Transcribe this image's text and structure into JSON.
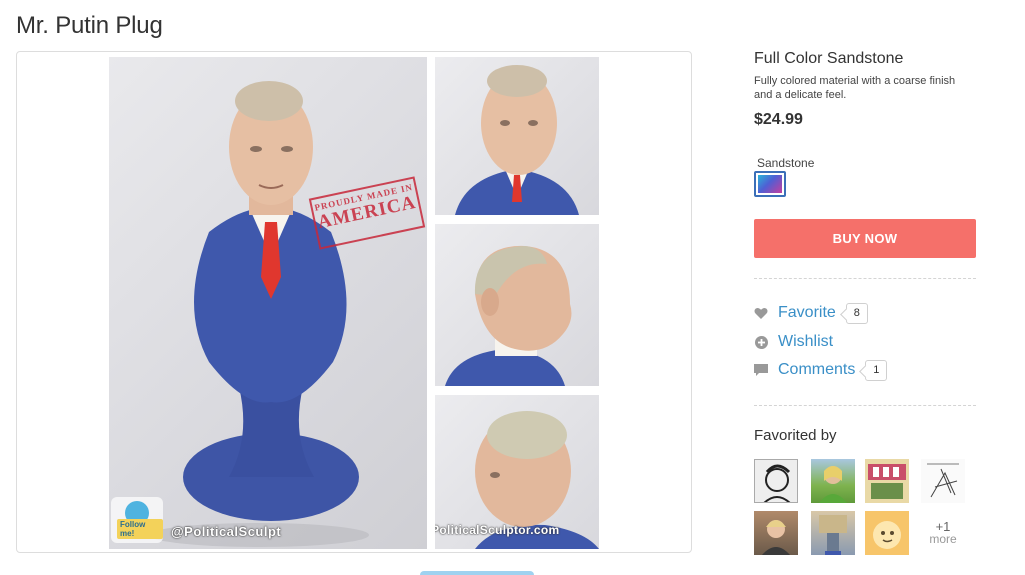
{
  "page": {
    "title": "Mr. Putin Plug"
  },
  "gallery": {
    "stamp_line1": "PROUDLY MADE IN",
    "stamp_line2": "AMERICA",
    "watermark_left": "@PoliticalSculpt",
    "watermark_right": "www.PoliticalSculptor.com",
    "follow_badge": "Follow me!"
  },
  "material": {
    "title": "Full Color Sandstone",
    "description": "Fully colored material with a coarse finish and a delicate feel.",
    "price": "$24.99",
    "swatch_label": "Sandstone"
  },
  "buy": {
    "label": "BUY NOW"
  },
  "actions": {
    "favorite": {
      "label": "Favorite",
      "count": "8"
    },
    "wishlist": {
      "label": "Wishlist"
    },
    "comments": {
      "label": "Comments",
      "count": "1"
    }
  },
  "favorited": {
    "heading": "Favorited by",
    "more_count": "+1",
    "more_label": "more"
  },
  "colors": {
    "accent_button": "#f5706a",
    "link": "#3a8fc7",
    "swatch_border": "#3b6fb8"
  },
  "icons": {
    "favorite": "heart-icon",
    "wishlist": "plus-circle-icon",
    "comments": "speech-bubble-icon"
  }
}
